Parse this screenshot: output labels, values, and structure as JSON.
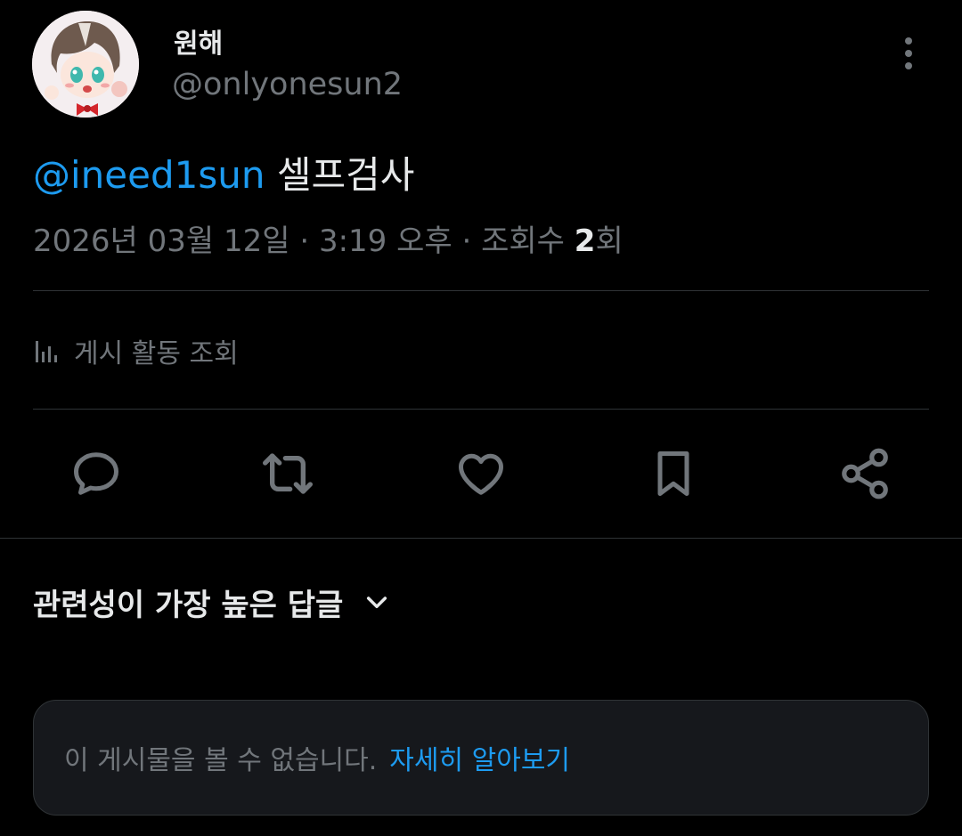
{
  "author": {
    "display_name": "원해",
    "handle": "@onlyonesun2"
  },
  "post": {
    "mention": "@ineed1sun",
    "body": "셀프검사"
  },
  "meta": {
    "date": "2026년 03월 12일",
    "separator": "·",
    "time": "3:19 오후",
    "views_label": "조회수",
    "views_count": "2",
    "views_unit": "회"
  },
  "activity": {
    "label": "게시 활동 조회"
  },
  "actions": {
    "reply_icon": "reply-icon",
    "repost_icon": "repost-icon",
    "like_icon": "heart-icon",
    "bookmark_icon": "bookmark-icon",
    "share_icon": "share-icon"
  },
  "replies": {
    "sort_label": "관련성이 가장 높은 답글"
  },
  "unavailable": {
    "message": "이 게시물을 볼 수 없습니다.",
    "link": "자세히 알아보기"
  },
  "colors": {
    "background": "#000000",
    "accent": "#1d9bf0",
    "text_primary": "#e7e9ea",
    "text_secondary": "#71767b",
    "divider": "#2f3336",
    "card_background": "#16181c"
  }
}
